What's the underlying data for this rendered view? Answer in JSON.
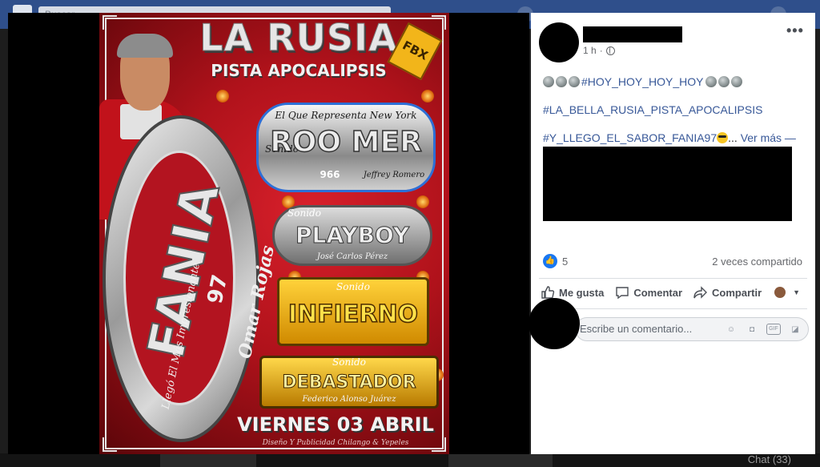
{
  "background": {
    "search_placeholder": "Buscar",
    "chat_label": "Chat (33)"
  },
  "poster": {
    "title": "LA RUSIA",
    "subtitle": "PISTA APOCALIPSIS",
    "badge": "FBX",
    "main_logo": "FANIA",
    "main_logo_number": "97",
    "main_logo_script": "Llegó El Más Impresionante",
    "owner_script": "Omar Rojas",
    "sound1_caption": "El Que Representa New York",
    "sound1_prefix": "Sonido",
    "sound1_name": "ROO MER",
    "sound1_number": "966",
    "sound1_owner": "Jeffrey Romero",
    "sound2_caption": "Sonido",
    "sound2_name": "PLAYBOY",
    "sound2_owner": "José Carlos Pérez",
    "sound3_caption": "Sonido",
    "sound3_name": "INFIERNO",
    "sound4_caption": "Sonido",
    "sound4_name": "DEBASTADOR",
    "sound4_owner": "Federico Alonso Juárez",
    "date": "VIERNES 03 ABRIL",
    "credit": "Diseño Y Publicidad Chilango & Yepeles"
  },
  "post": {
    "time": "1 h",
    "privacy_icon": "globe-icon",
    "more_label": "•••",
    "line1": "#HOY_HOY_HOY_HOY",
    "line2": "#LA_BELLA_RUSIA_PISTA_APOCALIPSIS",
    "line3": "#Y_LLEGO_EL_SABOR_FANIA97",
    "line3_ellipsis": "...",
    "see_more": "Ver más —",
    "reaction_count": "5",
    "shares": "2 veces compartido",
    "actions": {
      "like": "Me gusta",
      "comment": "Comentar",
      "share": "Compartir"
    },
    "comment_placeholder": "Escribe un comentario...",
    "accent": "#385898",
    "like_blue": "#1877f2"
  }
}
